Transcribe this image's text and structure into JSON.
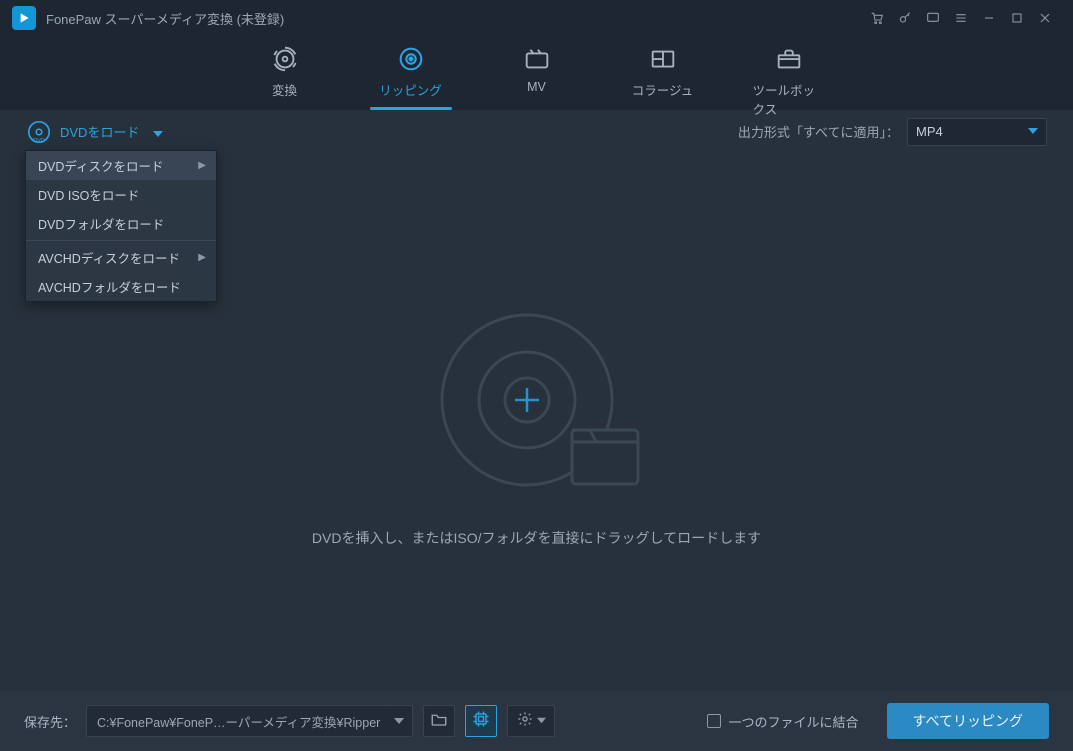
{
  "titlebar": {
    "app_title": "FonePaw スーパーメディア変換 (未登録)"
  },
  "nav": {
    "tabs": [
      {
        "id": "convert",
        "label": "変換"
      },
      {
        "id": "ripping",
        "label": "リッピング"
      },
      {
        "id": "mv",
        "label": "MV"
      },
      {
        "id": "collage",
        "label": "コラージュ"
      },
      {
        "id": "toolbox",
        "label": "ツールボックス"
      }
    ],
    "active": "ripping"
  },
  "actionbar": {
    "load_label": "DVDをロード",
    "output_label": "出力形式「すべてに適用」：",
    "output_value": "MP4"
  },
  "load_menu": {
    "items": [
      {
        "label": "DVDディスクをロード",
        "submenu": true,
        "hover": true
      },
      {
        "label": "DVD ISOをロード",
        "submenu": false
      },
      {
        "label": "DVDフォルダをロード",
        "submenu": false
      }
    ],
    "items2": [
      {
        "label": "AVCHDディスクをロード",
        "submenu": true
      },
      {
        "label": "AVCHDフォルダをロード",
        "submenu": false
      }
    ]
  },
  "main": {
    "hint": "DVDを挿入し、またはISO/フォルダを直接にドラッグしてロードします"
  },
  "bottombar": {
    "save_label": "保存先：",
    "save_path": "C:¥FonePaw¥FoneP…ーパーメディア変換¥Ripper",
    "merge_label": "一つのファイルに結合",
    "rip_label": "すべてリッピング"
  }
}
